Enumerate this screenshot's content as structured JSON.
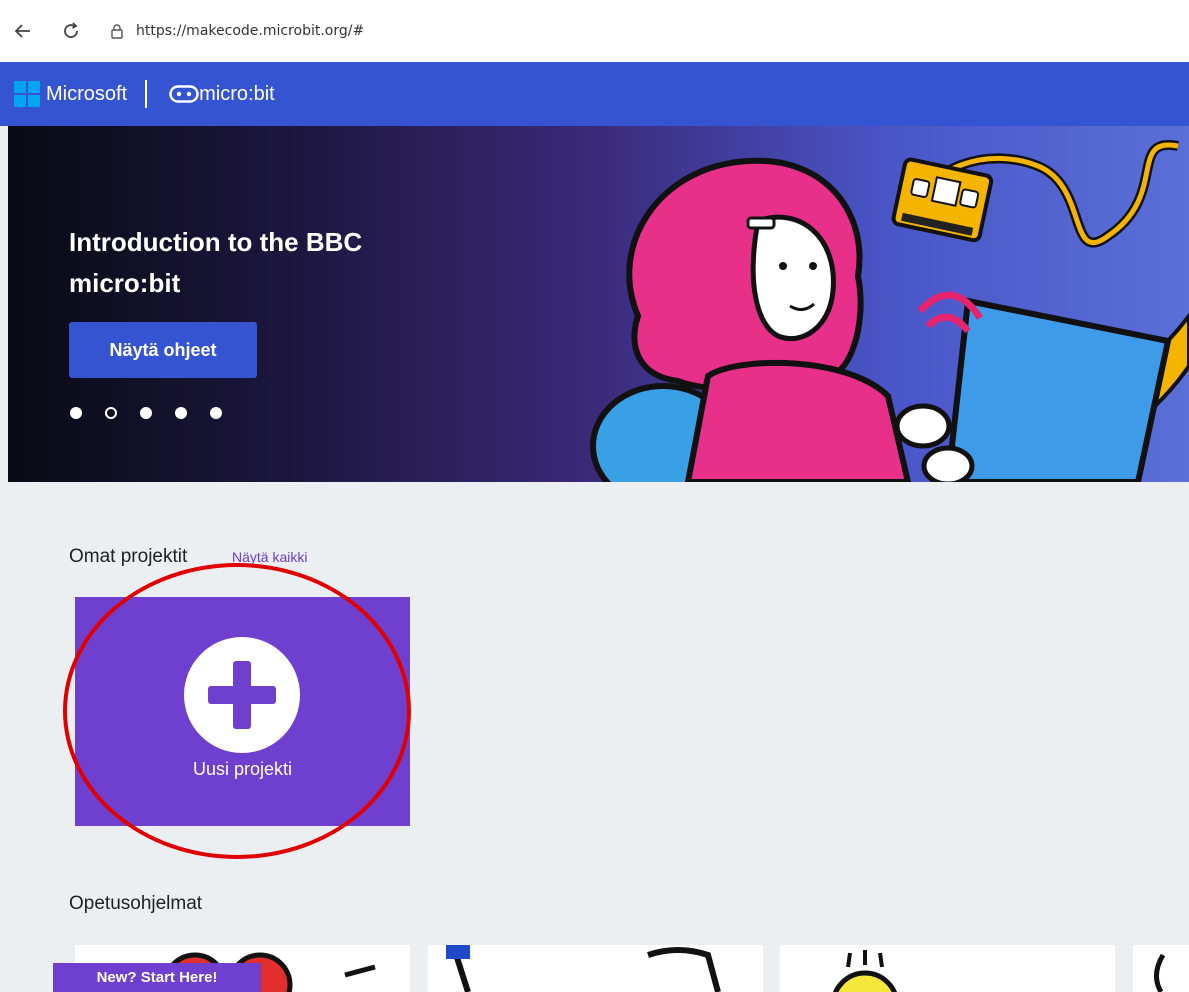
{
  "browser": {
    "url": "https://makecode.microbit.org/#"
  },
  "header": {
    "brand_microsoft": "Microsoft",
    "brand_microbit": "micro:bit",
    "colors": {
      "bar": "#3454d1",
      "ms_red": "#f25022",
      "ms_green": "#7fba00",
      "ms_blue": "#00a4ef",
      "ms_yellow": "#ffb900"
    }
  },
  "hero": {
    "title": "Introduction to the BBC micro:bit",
    "button_label": "Näytä ohjeet",
    "carousel": {
      "count": 5,
      "active_index": 1
    }
  },
  "my_projects": {
    "title": "Omat projektit",
    "see_all": "Näytä kaikki",
    "new_project_label": "Uusi projekti",
    "accent": "#6f3fcf"
  },
  "tutorials": {
    "title": "Opetusohjelmat",
    "badge": "New? Start Here!"
  },
  "annotation": {
    "color": "#e00000"
  }
}
